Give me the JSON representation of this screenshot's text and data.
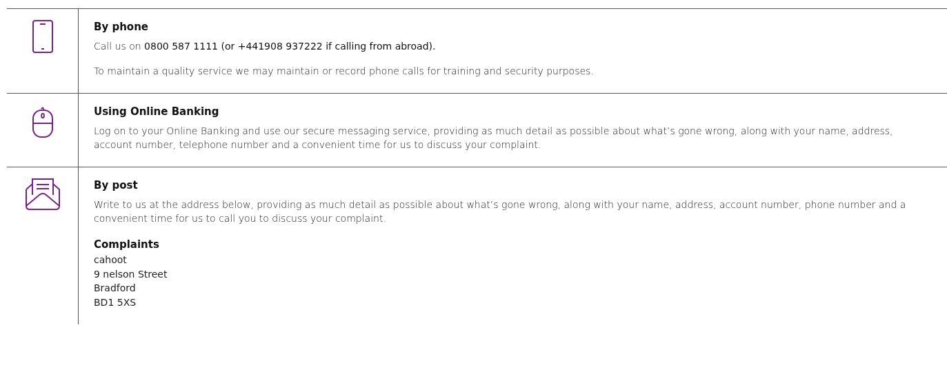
{
  "methods": [
    {
      "kind": "phone",
      "title": "By phone",
      "paragraphs": [
        "Call us on **0800 587 1111 (or +441908 937222 if calling from abroad).**",
        "To maintain a quality service we may maintain or record phone calls for training and security purposes."
      ]
    },
    {
      "kind": "mouse",
      "title": "Using Online Banking",
      "paragraphs": [
        "Log on to your Online Banking and use our secure messaging service, providing as much detail as possible about what’s gone wrong, along with your name, address, account number, telephone number and a convenient time for us to discuss your complaint."
      ]
    },
    {
      "kind": "envelope",
      "title": "By post",
      "paragraphs": [
        "Write to us at the address below, providing as much detail as possible about what’s gone wrong, along with your name, address, account number, phone number and a convenient time for us to call you to discuss your complaint."
      ],
      "address": {
        "heading": "Complaints",
        "lines": [
          "cahoot",
          "9 nelson Street",
          "Bradford",
          "BD1 5XS"
        ]
      }
    }
  ]
}
